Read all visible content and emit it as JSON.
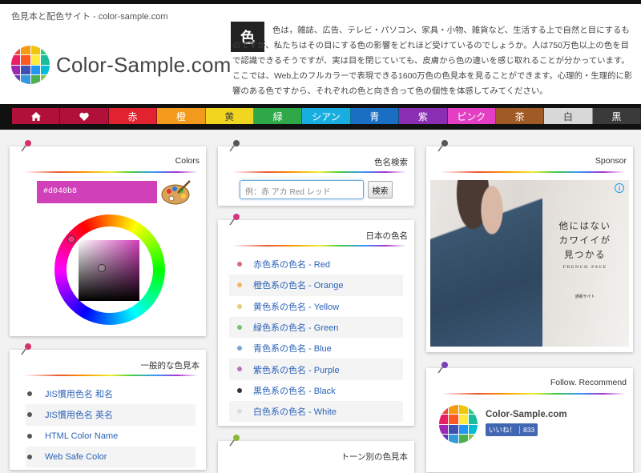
{
  "site_tag": "色見本と配色サイト - color-sample.com",
  "logo_text": "Color-Sample.com",
  "intro": {
    "kanji": "色",
    "text": "色は，雑誌、広告、テレビ・パソコン、家具・小物、雑貨など、生活する上で自然と目にするものですが、私たちはその目にする色の影響をどれほど受けているのでしょうか。人は750万色以上の色を目で認識できるそうですが、実は目を閉じていても、皮膚から色の違いを感じ取れることが分かっています。ここでは、Web上のフルカラーで表現できる1600万色の色見本を見ることができます。心理的・生理的に影響のある色ですから、それぞれの色と向き合って色の個性を体感してみてください。"
  },
  "nav": [
    {
      "label": "",
      "icon": "home-icon",
      "color": "#b0103a"
    },
    {
      "label": "",
      "icon": "heart-icon",
      "color": "#b0103a"
    },
    {
      "label": "赤",
      "color": "#e0232f"
    },
    {
      "label": "橙",
      "color": "#f39a1d"
    },
    {
      "label": "黄",
      "color": "#f1d51f"
    },
    {
      "label": "緑",
      "color": "#2fa84a"
    },
    {
      "label": "シアン",
      "color": "#18aee0"
    },
    {
      "label": "青",
      "color": "#1b6fc2"
    },
    {
      "label": "紫",
      "color": "#8a2fb3"
    },
    {
      "label": "ピンク",
      "color": "#e43fc4"
    },
    {
      "label": "茶",
      "color": "#a05a26"
    },
    {
      "label": "白",
      "color": "#d8d8d8"
    },
    {
      "label": "黒",
      "color": "#3a3a3a"
    }
  ],
  "colors_card": {
    "title": "Colors",
    "hex": "#d040b8",
    "selected_color": "#d040b8"
  },
  "search_card": {
    "title": "色名検索",
    "placeholder": "例：赤 アカ Red レッド",
    "button": "検索"
  },
  "jp_card": {
    "title": "日本の色名",
    "items": [
      {
        "label": "赤色系の色名 - Red",
        "dot": "#d96a7a"
      },
      {
        "label": "橙色系の色名 - Orange",
        "dot": "#f5b85c"
      },
      {
        "label": "黄色系の色名 - Yellow",
        "dot": "#e8cc74"
      },
      {
        "label": "緑色系の色名 - Green",
        "dot": "#7cc077"
      },
      {
        "label": "青色系の色名 - Blue",
        "dot": "#7aa6d6"
      },
      {
        "label": "紫色系の色名 - Purple",
        "dot": "#c16fc2"
      },
      {
        "label": "黒色系の色名 - Black",
        "dot": "#333333"
      },
      {
        "label": "白色系の色名 - White",
        "dot": "#dddddd"
      }
    ]
  },
  "general_card": {
    "title": "一般的な色見本",
    "items": [
      "JIS慣用色名 和名",
      "JIS慣用色名 英名",
      "HTML Color Name",
      "Web Safe Color"
    ]
  },
  "tone_card": {
    "title": "トーン別の色見本"
  },
  "sponsor_card": {
    "title": "Sponsor",
    "ad_lines": [
      "他にはない",
      "カワイイが",
      "見つかる"
    ],
    "ad_brand": "FRENCH PAVE",
    "ad_small": "通販サイト",
    "ad_info": "i"
  },
  "follow_card": {
    "title": "Follow. Recommend",
    "name": "Color-Sample.com",
    "like_label": "いいね！",
    "like_count": "833"
  },
  "pin_colors": {
    "red": "#d6336c",
    "magenta": "#d63384",
    "green": "#8ab83a",
    "purple": "#7b3fb8",
    "dark": "#555555"
  },
  "logo_colors": [
    "#e84b3c",
    "#f39c12",
    "#f1c40f",
    "#2ecc71",
    "#e91e63",
    "#ff5722",
    "#ffeb3b",
    "#1abc9c",
    "#9c27b0",
    "#3f51b5",
    "#2196f3",
    "#00bcd4",
    "#673ab7",
    "#3498db",
    "#4caf50",
    "#8bc34a"
  ]
}
